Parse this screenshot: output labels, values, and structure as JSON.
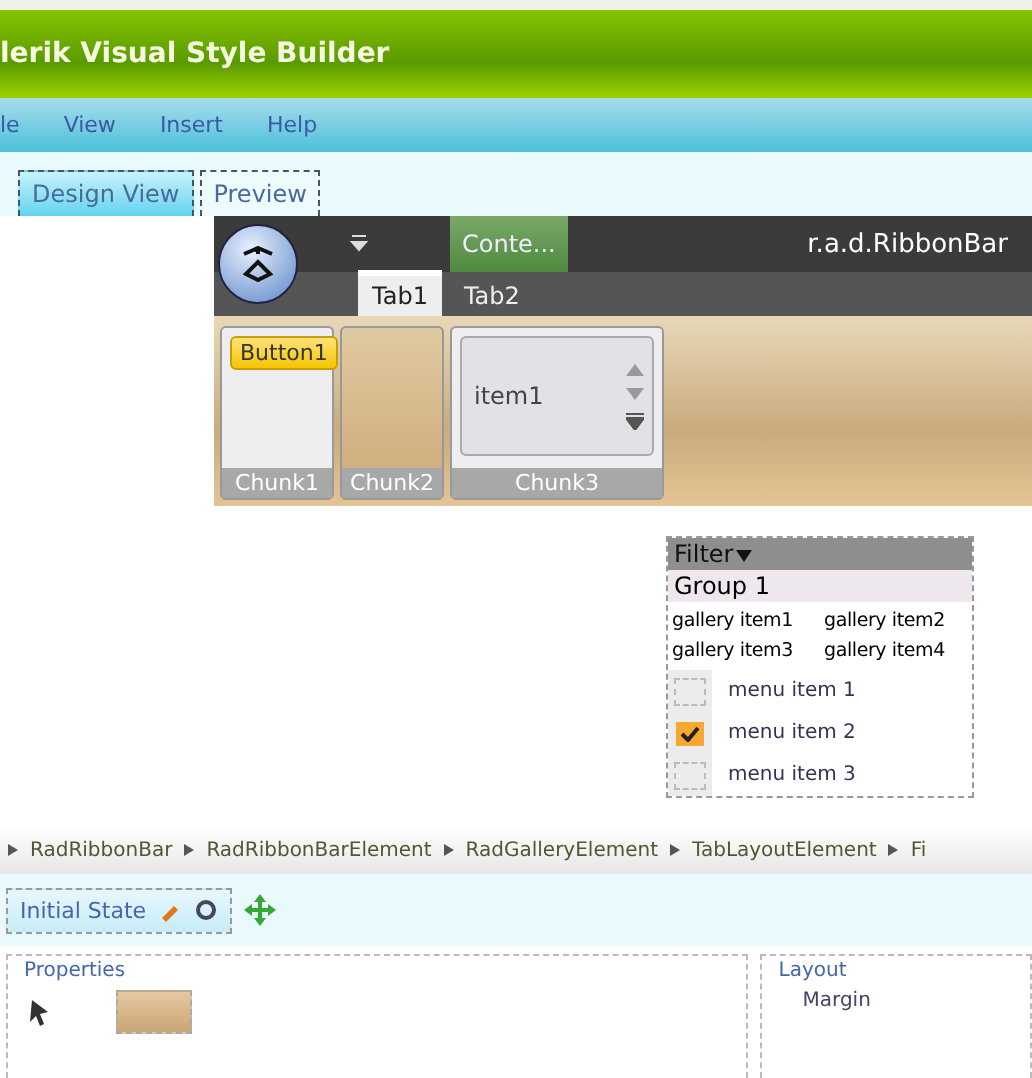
{
  "window": {
    "title": "lerik Visual Style Builder"
  },
  "menu": [
    "le",
    "View",
    "Insert",
    "Help"
  ],
  "view_tabs": [
    {
      "label": "Design View",
      "selected": true
    },
    {
      "label": "Preview",
      "selected": false
    }
  ],
  "ribbon": {
    "quick_access": "Conte...",
    "title": "r.a.d.RibbonBar",
    "tabs": [
      {
        "label": "Tab1",
        "selected": true
      },
      {
        "label": "Tab2",
        "selected": false
      }
    ],
    "chunks": [
      {
        "label": "Chunk1",
        "kind": "button",
        "button": "Button1"
      },
      {
        "label": "Chunk2",
        "kind": "empty"
      },
      {
        "label": "Chunk3",
        "kind": "gallery",
        "item": "item1"
      }
    ]
  },
  "gallery_dropdown": {
    "filter": "Filter",
    "group": "Group 1",
    "items": [
      "gallery item1",
      "gallery item2",
      "gallery item3",
      "gallery item4"
    ],
    "menu_items": [
      {
        "label": "menu item 1",
        "checked": false
      },
      {
        "label": "menu item 2",
        "checked": true
      },
      {
        "label": "menu item 3",
        "checked": false
      }
    ]
  },
  "breadcrumb": [
    "RadRibbonBar",
    "RadRibbonBarElement",
    "RadGalleryElement",
    "TabLayoutElement",
    "Fi"
  ],
  "toolbar": {
    "state": "Initial State"
  },
  "panels": [
    {
      "title": "Properties"
    },
    {
      "title": "Layout",
      "value": "Margin"
    }
  ]
}
